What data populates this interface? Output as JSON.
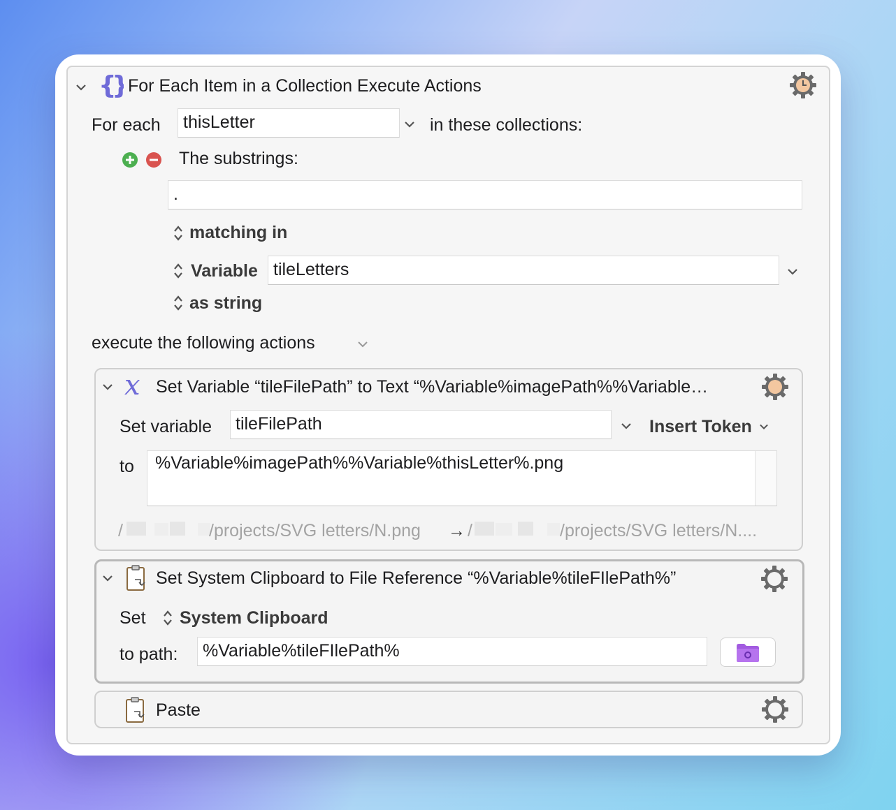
{
  "for_each_action": {
    "title": "For Each Item in a Collection Execute Actions",
    "for_each_label": "For each",
    "variable_value": "thisLetter",
    "in_collections_label": "in these collections:",
    "collection_title": "The substrings:",
    "substring_value": ".",
    "matching_label": "matching in",
    "source_label": "Variable",
    "source_variable": "tileLetters",
    "as_string_label": "as string",
    "execute_label": "execute the following actions"
  },
  "set_variable_action": {
    "title": "Set Variable “tileFilePath” to Text “%Variable%imagePath%%Variable…",
    "set_variable_label": "Set variable",
    "variable_name": "tileFilePath",
    "insert_token_label": "Insert Token",
    "to_label": "to",
    "text_value": "%Variable%imagePath%%Variable%thisLetter%.png",
    "preview_root": "/",
    "preview_left": "/projects/SVG letters/N.png",
    "preview_arrow": "→",
    "preview_root2": "/",
    "preview_right": "/projects/SVG letters/N...."
  },
  "clipboard_action": {
    "title": "Set System Clipboard to File Reference “%Variable%tileFIlePath%”",
    "set_label": "Set",
    "clipboard_label": "System Clipboard",
    "to_path_label": "to path:",
    "path_value": "%Variable%tileFIlePath%"
  },
  "paste_action": {
    "title": "Paste"
  },
  "colors": {
    "accent_purple": "#6f6bd8",
    "add_green": "#4caf50",
    "remove_red": "#d9534f",
    "folder_purple": "#a25be0",
    "gear_orange": "#f3c7a0"
  },
  "icons": [
    "chevron-down-icon",
    "braces-icon",
    "gear-clock-icon",
    "add-icon",
    "remove-icon",
    "updown-icon",
    "variable-x-icon",
    "gear-icon",
    "clipboard-icon",
    "folder-icon"
  ]
}
